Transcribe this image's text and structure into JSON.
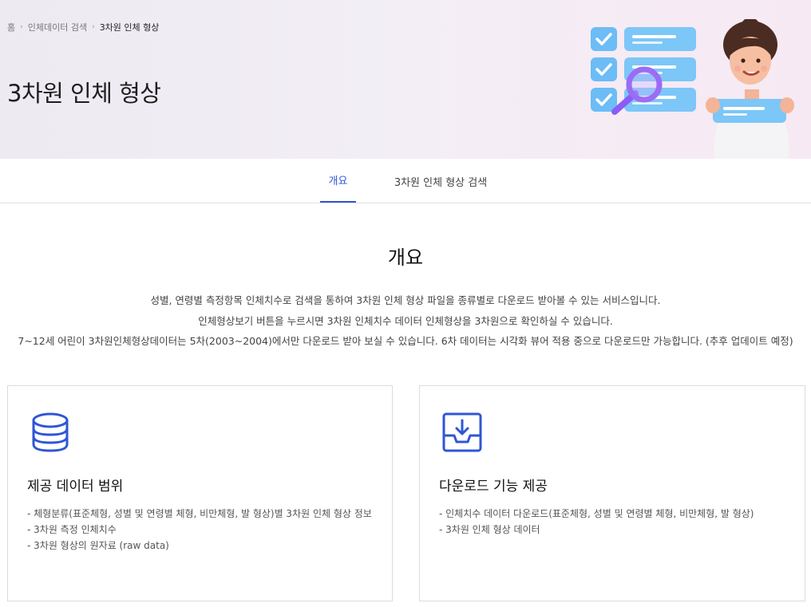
{
  "breadcrumb": {
    "home": "홈",
    "parent": "인체데이터 검색",
    "current": "3차원 인체 형상"
  },
  "page_title": "3차원 인체 형상",
  "tabs": [
    {
      "label": "개요",
      "active": true
    },
    {
      "label": "3차원 인체 형상 검색",
      "active": false
    }
  ],
  "overview": {
    "title": "개요",
    "lines": [
      "성별, 연령별 측정항목 인체치수로 검색을 통하여 3차원 인체 형상 파일을 종류별로 다운로드 받아볼 수 있는 서비스입니다.",
      "인체형상보기 버튼을 누르시면 3차원 인체치수 데이터 인체형상을 3차원으로 확인하실 수 있습니다.",
      "7~12세 어린이 3차원인체형상데이터는 5차(2003~2004)에서만 다운로드 받아 보실 수 있습니다. 6차 데이터는 시각화 뷰어 적용 중으로 다운로드만 가능합니다. (추후 업데이트 예정)"
    ]
  },
  "cards": [
    {
      "icon": "database-icon",
      "title": "제공 데이터 범위",
      "items": [
        "- 체형분류(표준체형, 성별 및 연령별 체형, 비만체형, 발 형상)별 3차원 인체 형상 정보",
        "- 3차원 측정 인체치수",
        "- 3차원 형상의 원자료 (raw data)"
      ]
    },
    {
      "icon": "download-tray-icon",
      "title": "다운로드 기능 제공",
      "items": [
        "- 인체치수 데이터 다운로드(표준체형, 성별 및 연령별 체형, 비만체형, 발 형상)",
        "- 3차원 인체 형상 데이터"
      ]
    }
  ],
  "colors": {
    "accent": "#2f56d6",
    "checklist_blue": "#5fb4f5",
    "magnifier_purple": "#8b5cf6"
  }
}
